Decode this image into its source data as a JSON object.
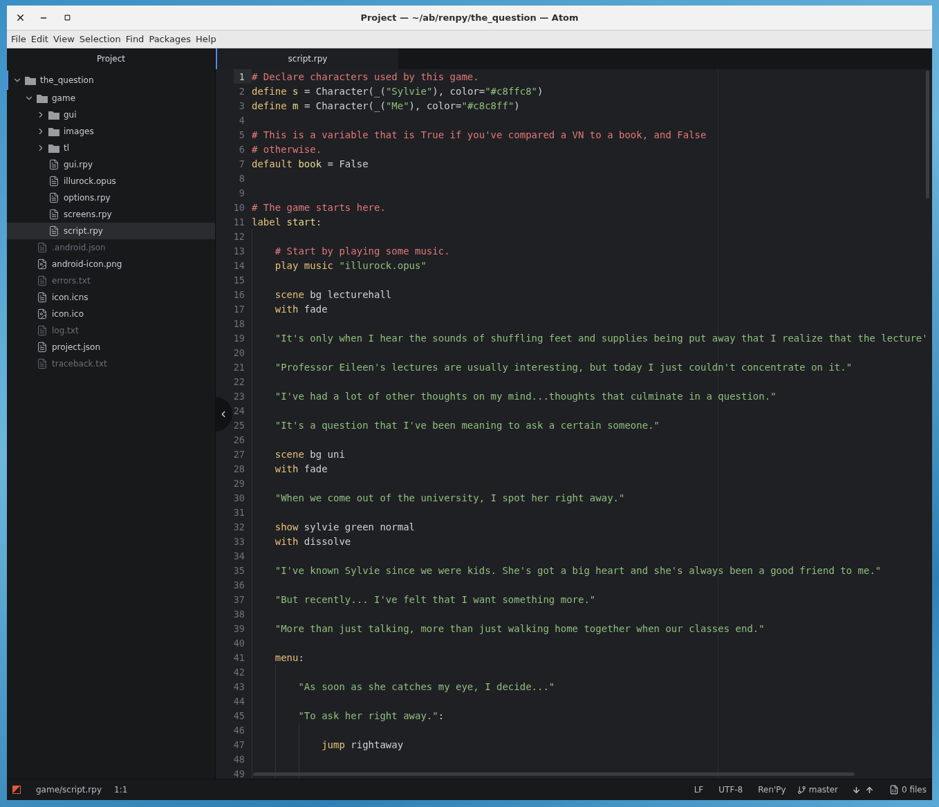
{
  "window": {
    "title": "Project — ~/ab/renpy/the_question — Atom"
  },
  "menu": [
    "File",
    "Edit",
    "View",
    "Selection",
    "Find",
    "Packages",
    "Help"
  ],
  "sidebar": {
    "title": "Project",
    "tree": [
      {
        "name": "the_question",
        "kind": "folder",
        "expanded": true,
        "selected": false,
        "dimmed": false,
        "children": [
          {
            "name": "game",
            "kind": "folder",
            "expanded": true,
            "selected": false,
            "dimmed": false,
            "children": [
              {
                "name": "gui",
                "kind": "folder",
                "expanded": false,
                "selected": false,
                "dimmed": false
              },
              {
                "name": "images",
                "kind": "folder",
                "expanded": false,
                "selected": false,
                "dimmed": false
              },
              {
                "name": "tl",
                "kind": "folder",
                "expanded": false,
                "selected": false,
                "dimmed": false
              },
              {
                "name": "gui.rpy",
                "kind": "file",
                "selected": false,
                "dimmed": false
              },
              {
                "name": "illurock.opus",
                "kind": "file",
                "selected": false,
                "dimmed": false
              },
              {
                "name": "options.rpy",
                "kind": "file",
                "selected": false,
                "dimmed": false
              },
              {
                "name": "screens.rpy",
                "kind": "file",
                "selected": false,
                "dimmed": false
              },
              {
                "name": "script.rpy",
                "kind": "file",
                "selected": true,
                "dimmed": false
              }
            ]
          },
          {
            "name": ".android.json",
            "kind": "file",
            "selected": false,
            "dimmed": true
          },
          {
            "name": "android-icon.png",
            "kind": "image",
            "selected": false,
            "dimmed": false
          },
          {
            "name": "errors.txt",
            "kind": "file",
            "selected": false,
            "dimmed": true
          },
          {
            "name": "icon.icns",
            "kind": "file",
            "selected": false,
            "dimmed": false
          },
          {
            "name": "icon.ico",
            "kind": "image",
            "selected": false,
            "dimmed": false
          },
          {
            "name": "log.txt",
            "kind": "file",
            "selected": false,
            "dimmed": true
          },
          {
            "name": "project.json",
            "kind": "file",
            "selected": false,
            "dimmed": false
          },
          {
            "name": "traceback.txt",
            "kind": "file",
            "selected": false,
            "dimmed": true
          }
        ]
      }
    ]
  },
  "tabs": [
    {
      "label": "script.rpy",
      "selected": true
    }
  ],
  "editor": {
    "lines": [
      {
        "number": "1",
        "current": true,
        "tokens": [
          {
            "kind": "comment",
            "text": "# Declare characters used by this game."
          }
        ]
      },
      {
        "number": "2",
        "current": false,
        "tokens": [
          {
            "kind": "keyword",
            "text": "define "
          },
          {
            "kind": "name",
            "text": "s"
          },
          {
            "kind": "plain",
            "text": " = Character(_("
          },
          {
            "kind": "string",
            "text": "\"Sylvie\""
          },
          {
            "kind": "plain",
            "text": "), color="
          },
          {
            "kind": "string",
            "text": "\"#c8ffc8\""
          },
          {
            "kind": "plain",
            "text": ")"
          }
        ]
      },
      {
        "number": "3",
        "current": false,
        "tokens": [
          {
            "kind": "keyword",
            "text": "define "
          },
          {
            "kind": "name",
            "text": "m"
          },
          {
            "kind": "plain",
            "text": " = Character(_("
          },
          {
            "kind": "string",
            "text": "\"Me\""
          },
          {
            "kind": "plain",
            "text": "), color="
          },
          {
            "kind": "string",
            "text": "\"#c8c8ff\""
          },
          {
            "kind": "plain",
            "text": ")"
          }
        ]
      },
      {
        "number": "4",
        "current": false
      },
      {
        "number": "5",
        "current": false,
        "tokens": [
          {
            "kind": "comment",
            "text": "# This is a variable that is True if you've compared a VN to a book, and False"
          }
        ]
      },
      {
        "number": "6",
        "current": false,
        "tokens": [
          {
            "kind": "comment",
            "text": "# otherwise."
          }
        ]
      },
      {
        "number": "7",
        "current": false,
        "tokens": [
          {
            "kind": "keyword",
            "text": "default "
          },
          {
            "kind": "name",
            "text": "book"
          },
          {
            "kind": "plain",
            "text": " = False"
          }
        ]
      },
      {
        "number": "8",
        "current": false
      },
      {
        "number": "9",
        "current": false
      },
      {
        "number": "10",
        "current": false,
        "tokens": [
          {
            "kind": "comment",
            "text": "# The game starts here."
          }
        ]
      },
      {
        "number": "11",
        "current": false,
        "tokens": [
          {
            "kind": "keyword",
            "text": "label "
          },
          {
            "kind": "name",
            "text": "start"
          },
          {
            "kind": "plain",
            "text": ":"
          }
        ]
      },
      {
        "number": "12",
        "current": false
      },
      {
        "number": "13",
        "current": false,
        "tokens": [
          {
            "kind": "comment",
            "text": "    # Start by playing some music."
          }
        ]
      },
      {
        "number": "14",
        "current": false,
        "tokens": [
          {
            "kind": "keyword",
            "text": "    play music "
          },
          {
            "kind": "string",
            "text": "\"illurock.opus\""
          }
        ]
      },
      {
        "number": "15",
        "current": false
      },
      {
        "number": "16",
        "current": false,
        "tokens": [
          {
            "kind": "keyword",
            "text": "    scene"
          },
          {
            "kind": "plain",
            "text": " bg lecturehall"
          }
        ]
      },
      {
        "number": "17",
        "current": false,
        "tokens": [
          {
            "kind": "keyword",
            "text": "    with"
          },
          {
            "kind": "plain",
            "text": " fade"
          }
        ]
      },
      {
        "number": "18",
        "current": false
      },
      {
        "number": "19",
        "current": false,
        "tokens": [
          {
            "kind": "string",
            "text": "    \"It's only when I hear the sounds of shuffling feet and supplies being put away that I realize that the lecture'"
          }
        ]
      },
      {
        "number": "20",
        "current": false
      },
      {
        "number": "21",
        "current": false,
        "tokens": [
          {
            "kind": "string",
            "text": "    \"Professor Eileen's lectures are usually interesting, but today I just couldn't concentrate on it.\""
          }
        ]
      },
      {
        "number": "22",
        "current": false
      },
      {
        "number": "23",
        "current": false,
        "tokens": [
          {
            "kind": "string",
            "text": "    \"I've had a lot of other thoughts on my mind...thoughts that culminate in a question.\""
          }
        ]
      },
      {
        "number": "24",
        "current": false
      },
      {
        "number": "25",
        "current": false,
        "tokens": [
          {
            "kind": "string",
            "text": "    \"It's a question that I've been meaning to ask a certain someone.\""
          }
        ]
      },
      {
        "number": "26",
        "current": false
      },
      {
        "number": "27",
        "current": false,
        "tokens": [
          {
            "kind": "keyword",
            "text": "    scene"
          },
          {
            "kind": "plain",
            "text": " bg uni"
          }
        ]
      },
      {
        "number": "28",
        "current": false,
        "tokens": [
          {
            "kind": "keyword",
            "text": "    with"
          },
          {
            "kind": "plain",
            "text": " fade"
          }
        ]
      },
      {
        "number": "29",
        "current": false
      },
      {
        "number": "30",
        "current": false,
        "tokens": [
          {
            "kind": "string",
            "text": "    \"When we come out of the university, I spot her right away.\""
          }
        ]
      },
      {
        "number": "31",
        "current": false
      },
      {
        "number": "32",
        "current": false,
        "tokens": [
          {
            "kind": "keyword",
            "text": "    show"
          },
          {
            "kind": "plain",
            "text": " sylvie green normal"
          }
        ]
      },
      {
        "number": "33",
        "current": false,
        "tokens": [
          {
            "kind": "keyword",
            "text": "    with"
          },
          {
            "kind": "plain",
            "text": " dissolve"
          }
        ]
      },
      {
        "number": "34",
        "current": false
      },
      {
        "number": "35",
        "current": false,
        "tokens": [
          {
            "kind": "string",
            "text": "    \"I've known Sylvie since we were kids. She's got a big heart and she's always been a good friend to me.\""
          }
        ]
      },
      {
        "number": "36",
        "current": false
      },
      {
        "number": "37",
        "current": false,
        "tokens": [
          {
            "kind": "string",
            "text": "    \"But recently... I've felt that I want something more.\""
          }
        ]
      },
      {
        "number": "38",
        "current": false
      },
      {
        "number": "39",
        "current": false,
        "tokens": [
          {
            "kind": "string",
            "text": "    \"More than just talking, more than just walking home together when our classes end.\""
          }
        ]
      },
      {
        "number": "40",
        "current": false
      },
      {
        "number": "41",
        "current": false,
        "tokens": [
          {
            "kind": "keyword",
            "text": "    menu"
          },
          {
            "kind": "plain",
            "text": ":"
          }
        ]
      },
      {
        "number": "42",
        "current": false
      },
      {
        "number": "43",
        "current": false,
        "tokens": [
          {
            "kind": "string",
            "text": "        \"As soon as she catches my eye, I decide...\""
          }
        ]
      },
      {
        "number": "44",
        "current": false
      },
      {
        "number": "45",
        "current": false,
        "tokens": [
          {
            "kind": "string",
            "text": "        \"To ask her right away.\""
          },
          {
            "kind": "plain",
            "text": ":"
          }
        ]
      },
      {
        "number": "46",
        "current": false
      },
      {
        "number": "47",
        "current": false,
        "tokens": [
          {
            "kind": "keyword",
            "text": "            jump"
          },
          {
            "kind": "plain",
            "text": " rightaway"
          }
        ]
      },
      {
        "number": "48",
        "current": false
      },
      {
        "number": "49",
        "current": false
      }
    ]
  },
  "status_bar": {
    "file_path": "game/script.rpy",
    "cursor_position": "1:1",
    "line_ending": "LF",
    "encoding": "UTF-8",
    "grammar": "Ren'Py",
    "branch": "master",
    "files": "0 files"
  }
}
